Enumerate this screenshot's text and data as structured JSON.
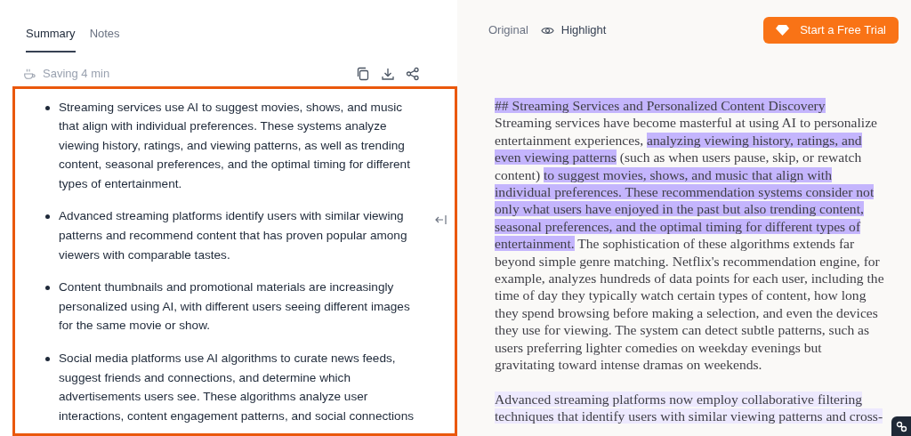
{
  "summary_panel": {
    "tabs": [
      {
        "label": "Summary",
        "selected": true
      },
      {
        "label": "Notes",
        "selected": false
      }
    ],
    "saving": "Saving 4 min",
    "bullets": [
      "Streaming services use AI to suggest movies, shows, and music that align with individual preferences. These systems analyze viewing history, ratings, and viewing patterns, as well as trending content, seasonal preferences, and the optimal timing for different types of entertainment.",
      "Advanced streaming platforms identify users with similar viewing patterns and recommend content that has proven popular among viewers with comparable tastes.",
      "Content thumbnails and promotional materials are increasingly personalized using AI, with different users seeing different images for the same movie or show.",
      "Social media platforms use AI algorithms to curate news feeds, suggest friends and connections, and determine which advertisements users see. These algorithms analyze user interactions, content engagement patterns, and social connections"
    ]
  },
  "original_panel": {
    "view_modes": [
      {
        "label": "Original",
        "selected": false
      },
      {
        "label": "Highlight",
        "selected": true
      }
    ],
    "trial_button": "Start a Free Trial",
    "paragraphs": [
      {
        "kind": "main",
        "segments": [
          {
            "text": "## Streaming Services and Personalized Content Discovery",
            "highlighted": true
          },
          {
            "text": " Streaming services have become masterful at using AI to personalize entertainment experiences, ",
            "highlighted": false
          },
          {
            "text": "analyzing viewing history, ratings, and even viewing patterns",
            "highlighted": true
          },
          {
            "text": " (such as when users pause, skip, or rewatch content) ",
            "highlighted": false
          },
          {
            "text": "to suggest movies, shows, and music that align with individual preferences. These recommendation systems consider not only what users have enjoyed in the past but also trending content, seasonal preferences, and the optimal timing for different types of entertainment.",
            "highlighted": true
          },
          {
            "text": " The sophistication of these algorithms extends far beyond simple genre matching. Netflix's recommendation engine, for example, analyzes hundreds of data points for each user, including the time of day they typically watch certain types of content, how long they spend browsing before making a selection, and even the devices they use for viewing. The system can detect subtle patterns, such as users preferring lighter comedies on weekday evenings but gravitating toward intense dramas on weekends.",
            "highlighted": false
          }
        ]
      },
      {
        "kind": "related",
        "segments": [
          {
            "text": "Advanced streaming platforms now employ collaborative filtering techniques that identify users with similar viewing patterns and cross-",
            "highlighted": true
          }
        ]
      }
    ]
  }
}
